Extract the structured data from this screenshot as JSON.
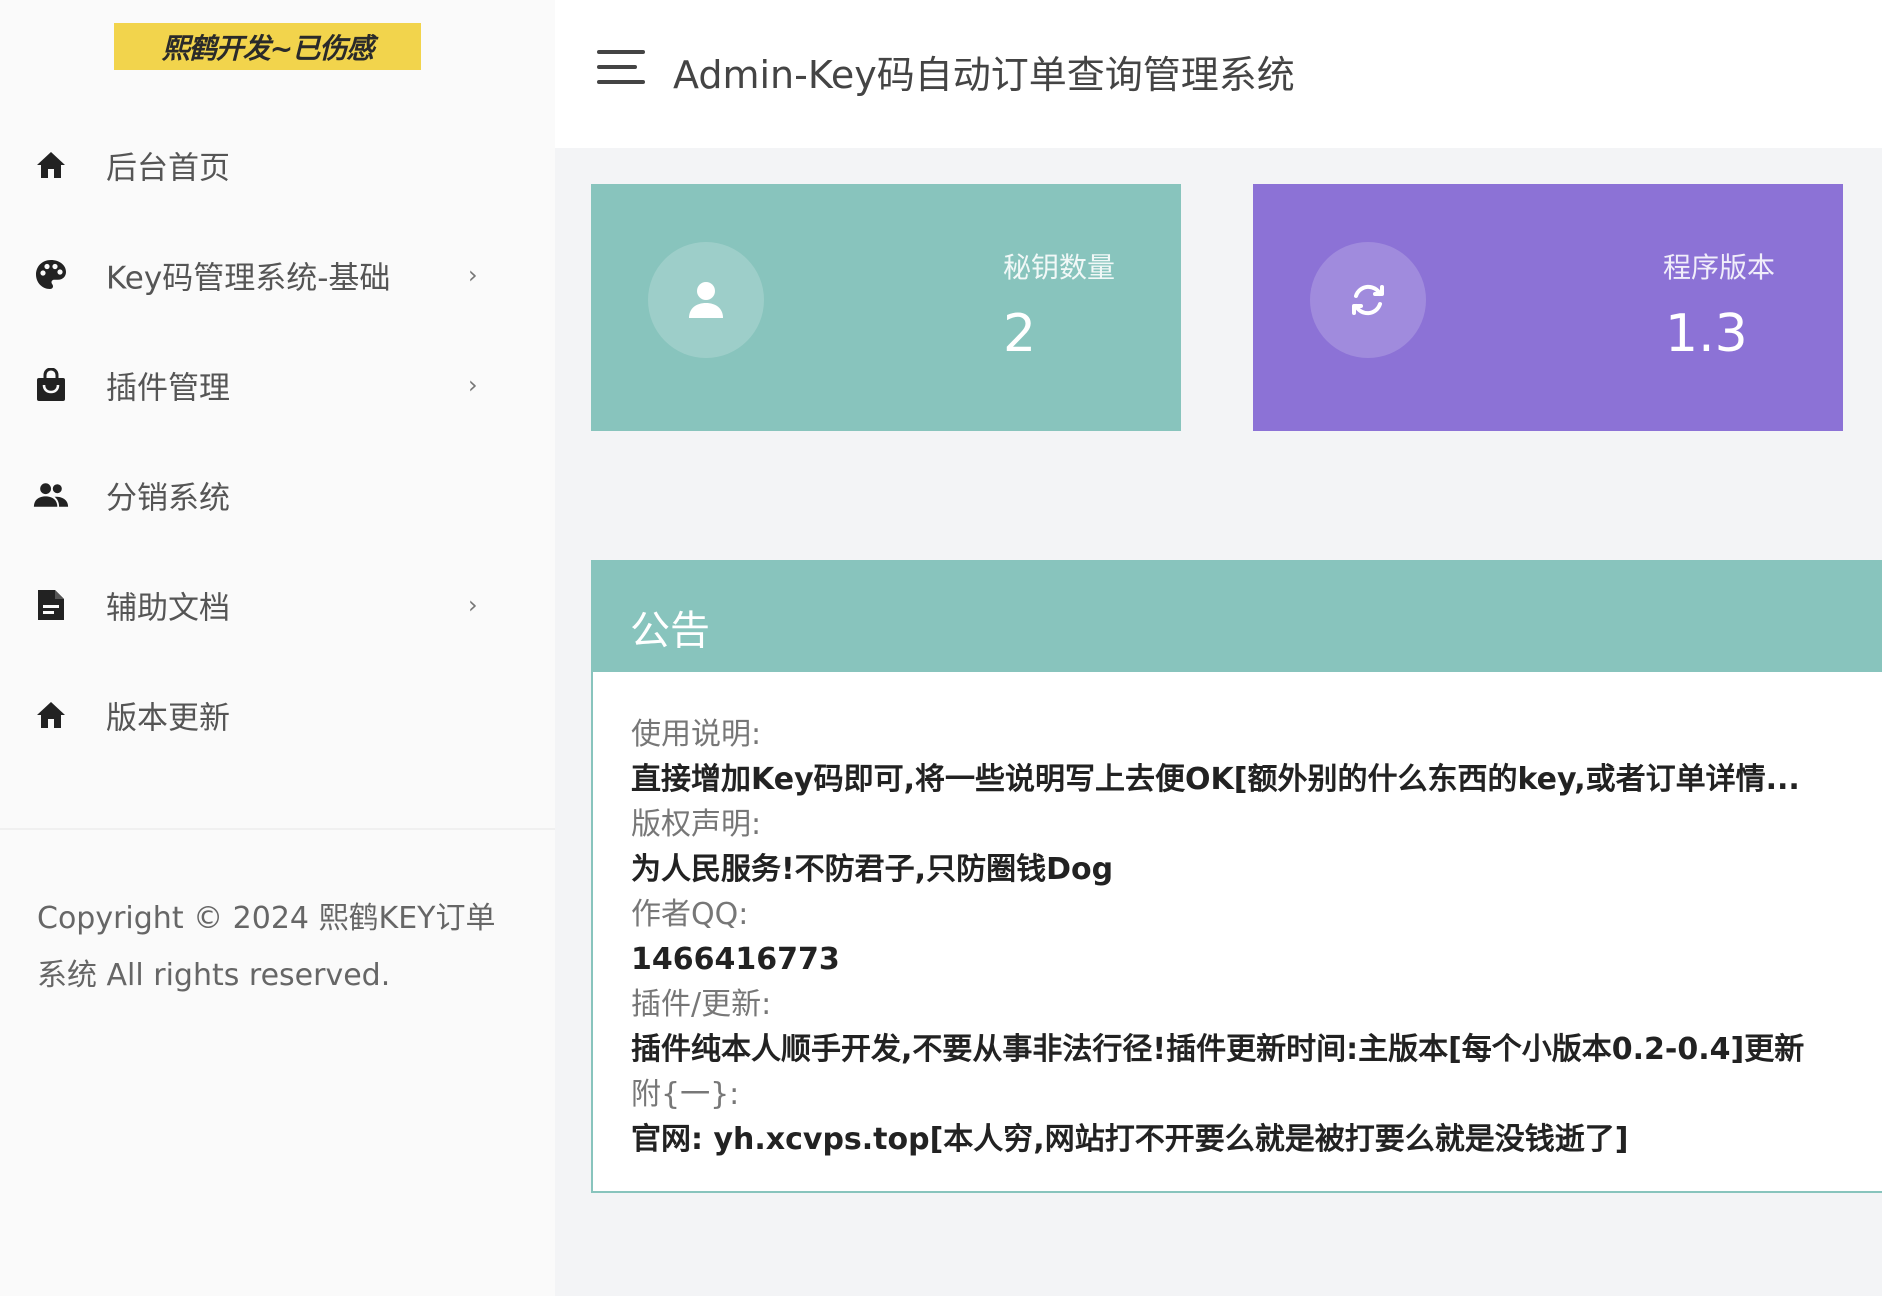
{
  "sidebar": {
    "logo_text": "熙鹤开发~已伤感",
    "items": [
      {
        "label": "后台首页",
        "icon": "home-icon",
        "has_arrow": false
      },
      {
        "label": "Key码管理系统-基础",
        "icon": "palette-icon",
        "has_arrow": true,
        "arrow": "›"
      },
      {
        "label": "插件管理",
        "icon": "bag-icon",
        "has_arrow": true,
        "arrow": "›"
      },
      {
        "label": "分销系统",
        "icon": "users-icon",
        "has_arrow": false
      },
      {
        "label": "辅助文档",
        "icon": "document-icon",
        "has_arrow": true,
        "arrow": "›"
      },
      {
        "label": "版本更新",
        "icon": "home-icon",
        "has_arrow": false
      }
    ],
    "copyright": "Copyright © 2024 熙鹤KEY订单系统 All rights reserved."
  },
  "header": {
    "title": "Admin-Key码自动订单查询管理系统"
  },
  "stats": [
    {
      "label": "秘钥数量",
      "value": "2",
      "icon": "user-icon",
      "color": "#88c4bd"
    },
    {
      "label": "程序版本",
      "value": "1.3",
      "icon": "refresh-icon",
      "color": "#8c72d6"
    }
  ],
  "notice": {
    "title": "公告",
    "entries": [
      {
        "label": "使用说明:",
        "value": "直接增加Key码即可,将一些说明写上去便OK[额外别的什么东西的key,或者订单详情..."
      },
      {
        "label": "版权声明:",
        "value": "为人民服务!不防君子,只防圈钱Dog"
      },
      {
        "label": "作者QQ:",
        "value": "1466416773"
      },
      {
        "label": "插件/更新:",
        "value": "插件纯本人顺手开发,不要从事非法行径!插件更新时间:主版本[每个小版本0.2-0.4]更新"
      },
      {
        "label": "附{一}:",
        "value": "官网: yh.xcvps.top[本人穷,网站打不开要么就是被打要么就是没钱逝了]"
      }
    ]
  },
  "colors": {
    "teal": "#88c4bd",
    "purple": "#8c72d6",
    "logo_bg": "#f2d44c"
  }
}
